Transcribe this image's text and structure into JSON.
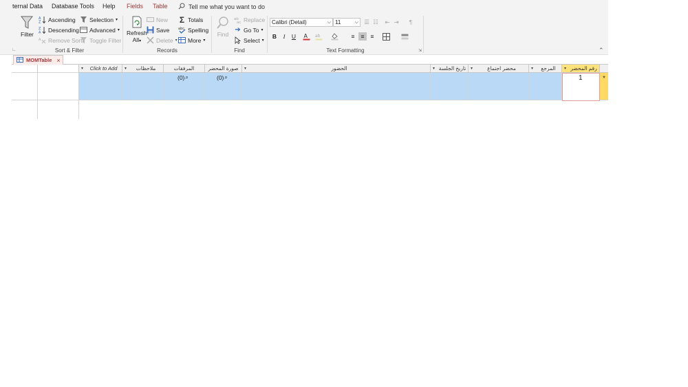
{
  "menu": {
    "items": [
      "ternal Data",
      "Database Tools",
      "Help"
    ],
    "context_items": [
      "Fields",
      "Table"
    ],
    "tell_me": "Tell me what you want to do"
  },
  "ribbon": {
    "sort_filter": {
      "filter": "Filter",
      "ascending": "Ascending",
      "descending": "Descending",
      "remove_sort": "Remove Sort",
      "selection": "Selection",
      "advanced": "Advanced",
      "toggle_filter": "Toggle Filter",
      "group_label": "Sort & Filter"
    },
    "records": {
      "refresh_line1": "Refresh",
      "refresh_line2": "All",
      "new": "New",
      "save": "Save",
      "delete": "Delete",
      "totals": "Totals",
      "spelling": "Spelling",
      "more": "More",
      "group_label": "Records"
    },
    "find": {
      "find": "Find",
      "replace": "Replace",
      "go_to": "Go To",
      "select": "Select",
      "group_label": "Find"
    },
    "text_formatting": {
      "font": "Calibri (Detail)",
      "size": "11",
      "bold": "B",
      "italic": "I",
      "underline": "U",
      "group_label": "Text Formatting"
    }
  },
  "tab": {
    "label": "MOMTable"
  },
  "columns": [
    {
      "label": "Click to Add",
      "italic": true
    },
    {
      "label": "ملاحظات"
    },
    {
      "label": "المرفقات"
    },
    {
      "label": "صورة المحضر"
    },
    {
      "label": "الحضور"
    },
    {
      "label": "تاريخ الجلسة"
    },
    {
      "label": "محضر اجتماع"
    },
    {
      "label": "المرجع"
    },
    {
      "label": "رقم المحضر"
    }
  ],
  "new_row": {
    "attachments_value": "(0)",
    "image_value": "(0)",
    "id_value": "1",
    "row_marker": "*"
  },
  "colors": {
    "selected_header": "#ffe27a",
    "new_row_fill": "#b9d9f7",
    "row_selector": "#ffd966",
    "context_tab": "#a4373a"
  }
}
